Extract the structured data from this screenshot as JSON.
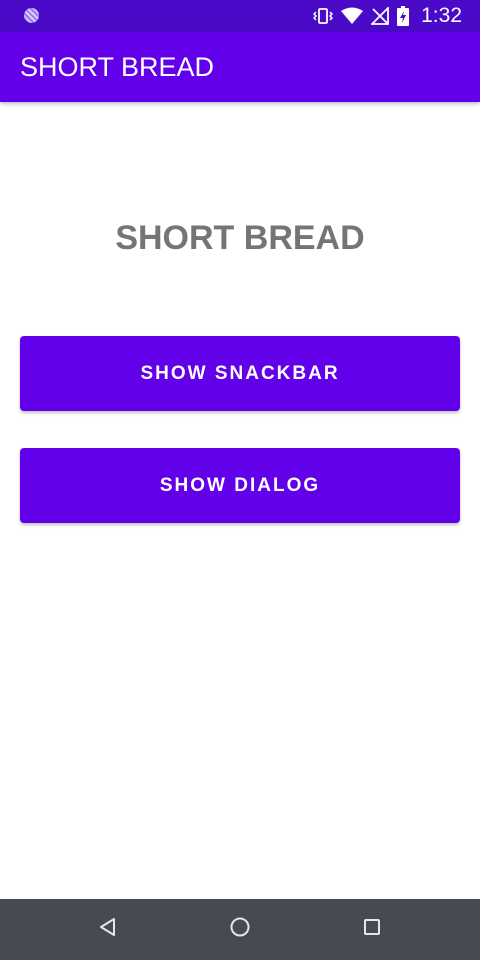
{
  "status_bar": {
    "time": "1:32",
    "icons": [
      "notification-dot-icon",
      "vibrate-icon",
      "wifi-icon",
      "no-signal-icon",
      "battery-charging-icon"
    ]
  },
  "app_bar": {
    "title": "SHORT BREAD"
  },
  "main": {
    "heading": "SHORT BREAD",
    "show_snackbar_label": "SHOW SNACKBAR",
    "show_dialog_label": "SHOW DIALOG"
  },
  "nav_bar": {
    "icons": [
      "back-icon",
      "home-icon",
      "recents-icon"
    ]
  },
  "colors": {
    "status_bar": "#4a0ac8",
    "primary": "#6200ea",
    "heading_text": "#757575",
    "nav_bar": "#464b52"
  }
}
